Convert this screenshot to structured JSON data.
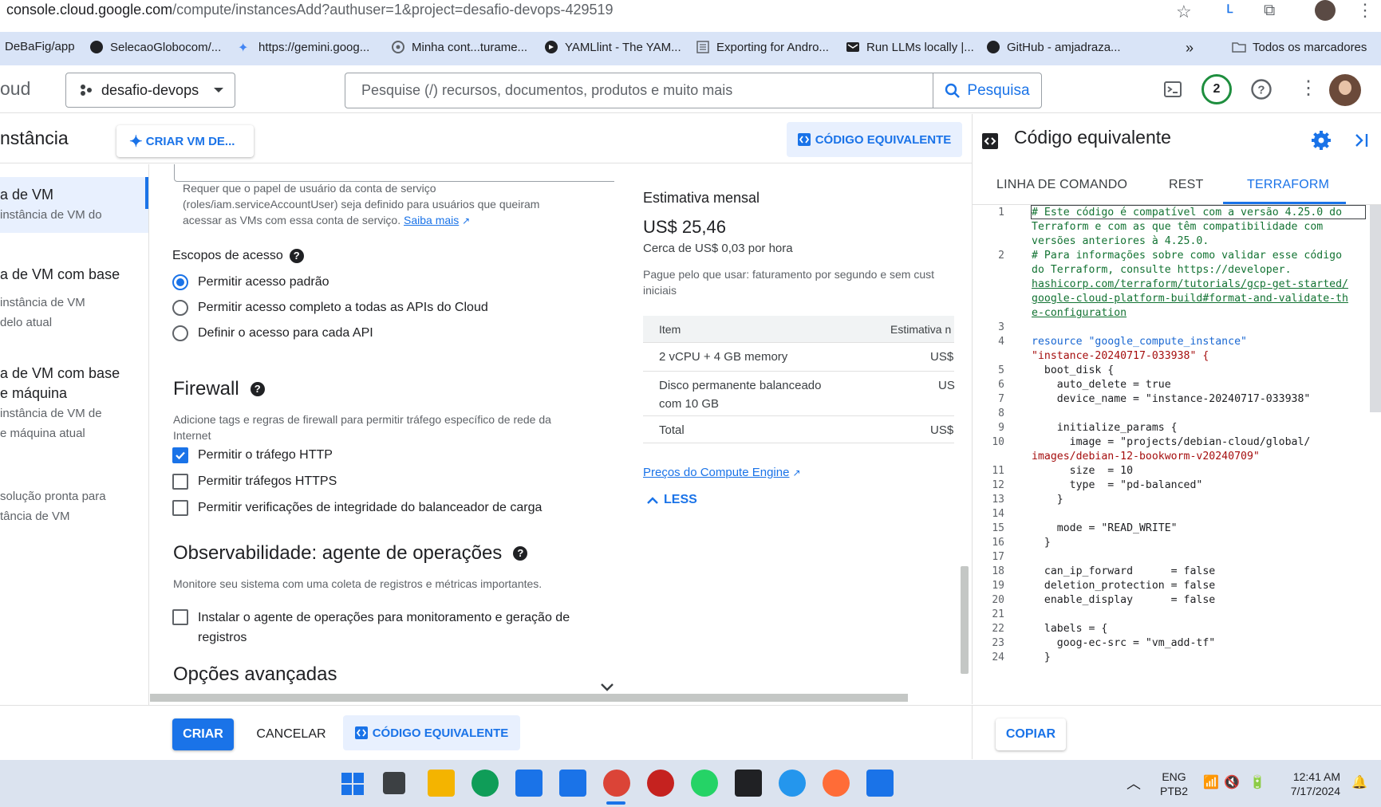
{
  "browser": {
    "url_host": "console.cloud.google.com",
    "url_path": "/compute/instancesAdd?authuser=1&project=desafio-devops-429519",
    "bookmarks": [
      "DeBaFig/app",
      "SelecaoGlobocom/...",
      "https://gemini.goog...",
      "Minha cont...turame...",
      "YAMLlint - The YAM...",
      "Exporting for Andro...",
      "Run LLMs locally |...",
      "GitHub - amjadraza...",
      "Todos os marcadores"
    ]
  },
  "header": {
    "brand": "oud",
    "project": "desafio-devops",
    "search_placeholder": "Pesquise (/) recursos, documentos, produtos e muito mais",
    "search_button": "Pesquisa",
    "notifications_count": "2"
  },
  "titlebar": {
    "title": "nstância",
    "create_vm_ai": "CRIAR VM DE...",
    "code_equivalent": "CÓDIGO EQUIVALENTE"
  },
  "leftnav": {
    "items": [
      {
        "title": "a de VM",
        "sub": [
          " instância de VM do"
        ]
      },
      {
        "title": "a de VM com base",
        "sub": [
          "instância de VM",
          "delo atual"
        ]
      },
      {
        "title_lines": [
          "a de VM com base",
          "e máquina"
        ],
        "sub": [
          "instância de VM de",
          "e máquina atual"
        ]
      },
      {
        "sub": [
          "solução pronta para",
          "tância de VM"
        ]
      }
    ]
  },
  "form": {
    "service_account_hint": "Requer que o papel de usuário da conta de serviço (roles/iam.serviceAccountUser) seja definido para usuários que queiram acessar as VMs com essa conta de serviço.",
    "learn_more": "Saiba mais",
    "access_scopes_label": "Escopos de acesso",
    "access_scopes": [
      {
        "label": "Permitir acesso padrão",
        "selected": true
      },
      {
        "label": "Permitir acesso completo a todas as APIs do Cloud",
        "selected": false
      },
      {
        "label": "Definir o acesso para cada API",
        "selected": false
      }
    ],
    "firewall_title": "Firewall",
    "firewall_desc": "Adicione tags e regras de firewall para permitir tráfego específico de rede da Internet",
    "firewall_options": [
      {
        "label": "Permitir o tráfego HTTP",
        "checked": true
      },
      {
        "label": "Permitir tráfegos HTTPS",
        "checked": false
      },
      {
        "label": "Permitir verificações de integridade do balanceador de carga",
        "checked": false
      }
    ],
    "observability_title": "Observabilidade: agente de operações",
    "observability_desc": "Monitore seu sistema com uma coleta de registros e métricas importantes.",
    "ops_agent_label_1": "Instalar o agente de operações para monitoramento e geração de",
    "ops_agent_label_2": "registros",
    "ops_agent_checked": false,
    "advanced_title": "Opções avançadas"
  },
  "estimate": {
    "title": "Estimativa mensal",
    "price": "US$ 25,46",
    "hourly": "Cerca de US$ 0,03 por hora",
    "note_1": "Pague pelo que usar: faturamento por segundo e sem cust",
    "note_2": "iniciais",
    "col_item": "Item",
    "col_estimate": "Estimativa n",
    "rows": [
      {
        "item": "2 vCPU + 4 GB memory",
        "value": "US$"
      },
      {
        "item": "Disco permanente balanceado",
        "item2": "com 10 GB",
        "value": "US"
      },
      {
        "item": "Total",
        "value": "US$"
      }
    ],
    "pricing_link": "Preços do Compute Engine",
    "less": "LESS"
  },
  "code_panel": {
    "title": "Código equivalente",
    "tabs": [
      "LINHA DE COMANDO",
      "REST",
      "TERRAFORM"
    ],
    "active_tab": "TERRAFORM",
    "line_numbers": [
      "1",
      "2",
      "3",
      "4",
      "5",
      "6",
      "7",
      "8",
      "9",
      "10",
      "11",
      "12",
      "13",
      "14",
      "15",
      "16",
      "17",
      "18",
      "19",
      "20",
      "21",
      "22",
      "23",
      "24"
    ],
    "lines": [
      "# Este código é compatível com a versão 4.25.0 do",
      "Terraform e com as que têm compatibilidade com",
      "versões anteriores à 4.25.0.",
      "# Para informações sobre como validar esse código",
      "do Terraform, consulte https://developer.",
      "hashicorp.com/terraform/tutorials/gcp-get-started/",
      "google-cloud-platform-build#format-and-validate-th",
      "e-configuration",
      "resource \"google_compute_instance\"",
      "\"instance-20240717-033938\" {",
      "  boot_disk {",
      "    auto_delete = true",
      "    device_name = \"instance-20240717-033938\"",
      "    initialize_params {",
      "      image = \"projects/debian-cloud/global/",
      "images/debian-12-bookworm-v20240709\"",
      "      size  = 10",
      "      type  = \"pd-balanced\"",
      "    }",
      "    mode = \"READ_WRITE\"",
      "  }",
      "  can_ip_forward      = false",
      "  deletion_protection = false",
      "  enable_display      = false",
      "  labels = {",
      "    goog-ec-src = \"vm_add-tf\"",
      "  }"
    ],
    "copy": "COPIAR"
  },
  "actions": {
    "create": "CRIAR",
    "cancel": "CANCELAR",
    "code_equivalent": "CÓDIGO EQUIVALENTE"
  },
  "taskbar": {
    "lang": "ENG",
    "layout": "PTB2",
    "time": "12:41 AM",
    "date": "7/17/2024"
  }
}
